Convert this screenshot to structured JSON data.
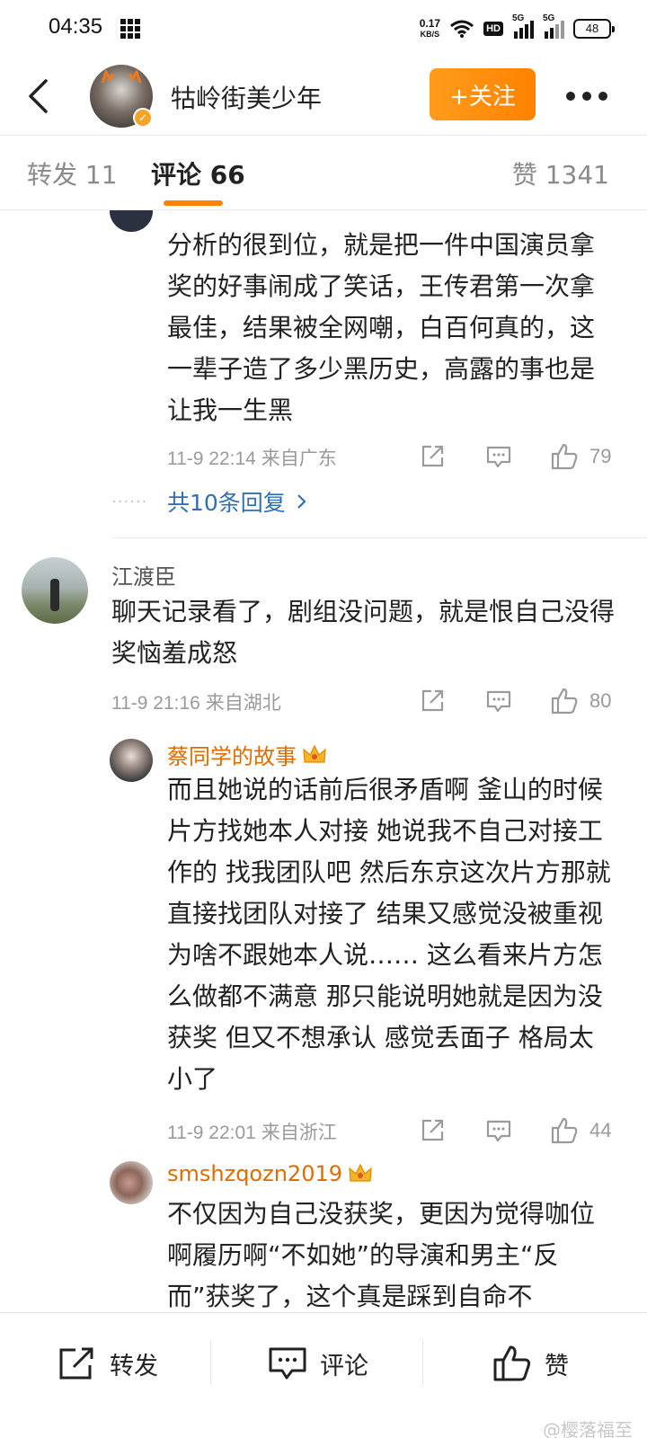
{
  "status_bar": {
    "time": "04:35",
    "net_speed_value": "0.17",
    "net_speed_unit": "KB/S",
    "hd_label": "HD",
    "sig1_label": "5G",
    "sig2_label": "5G",
    "battery": "48"
  },
  "header": {
    "name": "牯岭街美少年",
    "follow_label": "+关注"
  },
  "tabs": {
    "repost": "转发 11",
    "comments": "评论 66",
    "likes": "赞 1341"
  },
  "comments": [
    {
      "text": "分析的很到位，就是把一件中国演员拿奖的好事闹成了笑话，王传君第一次拿最佳，结果被全网嘲，白百何真的，这一辈子造了多少黑历史，高露的事也是让我一生黑",
      "meta": "11-9 22:14  来自广东",
      "likes": "79",
      "more_replies": "共10条回复"
    },
    {
      "name": "江渡臣",
      "text": "聊天记录看了，剧组没问题，就是恨自己没得奖恼羞成怒",
      "meta": "11-9 21:16  来自湖北",
      "likes": "80",
      "replies": [
        {
          "name": "蔡同学的故事",
          "text": "而且她说的话前后很矛盾啊 釜山的时候 片方找她本人对接 她说我不自己对接工作的 找我团队吧 然后东京这次片方那就直接找团队对接了 结果又感觉没被重视 为啥不跟她本人说…… 这么看来片方怎么做都不满意 那只能说明她就是因为没获奖 但又不想承认 感觉丢面子 格局太小了",
          "meta": "11-9 22:01  来自浙江",
          "likes": "44"
        },
        {
          "name": "smshzqozn2019",
          "text": "不仅因为自己没获奖，更因为觉得咖位啊履历啊“不如她”的导演和男主“反而”获奖了，这个真是踩到自命不"
        }
      ]
    }
  ],
  "bottom_bar": {
    "repost": "转发",
    "comment": "评论",
    "like": "赞",
    "watermark": "@樱落福至"
  },
  "colors": {
    "accent": "#ff8200",
    "link": "#2f6fb6",
    "reply_name": "#e06c00",
    "meta": "#9a9a9a"
  },
  "icons": [
    "back-arrow-icon",
    "verified-icon",
    "more-icon",
    "share-icon",
    "comment-icon",
    "like-icon",
    "crown-icon",
    "chevron-right-icon",
    "weibo-logo-icon"
  ]
}
